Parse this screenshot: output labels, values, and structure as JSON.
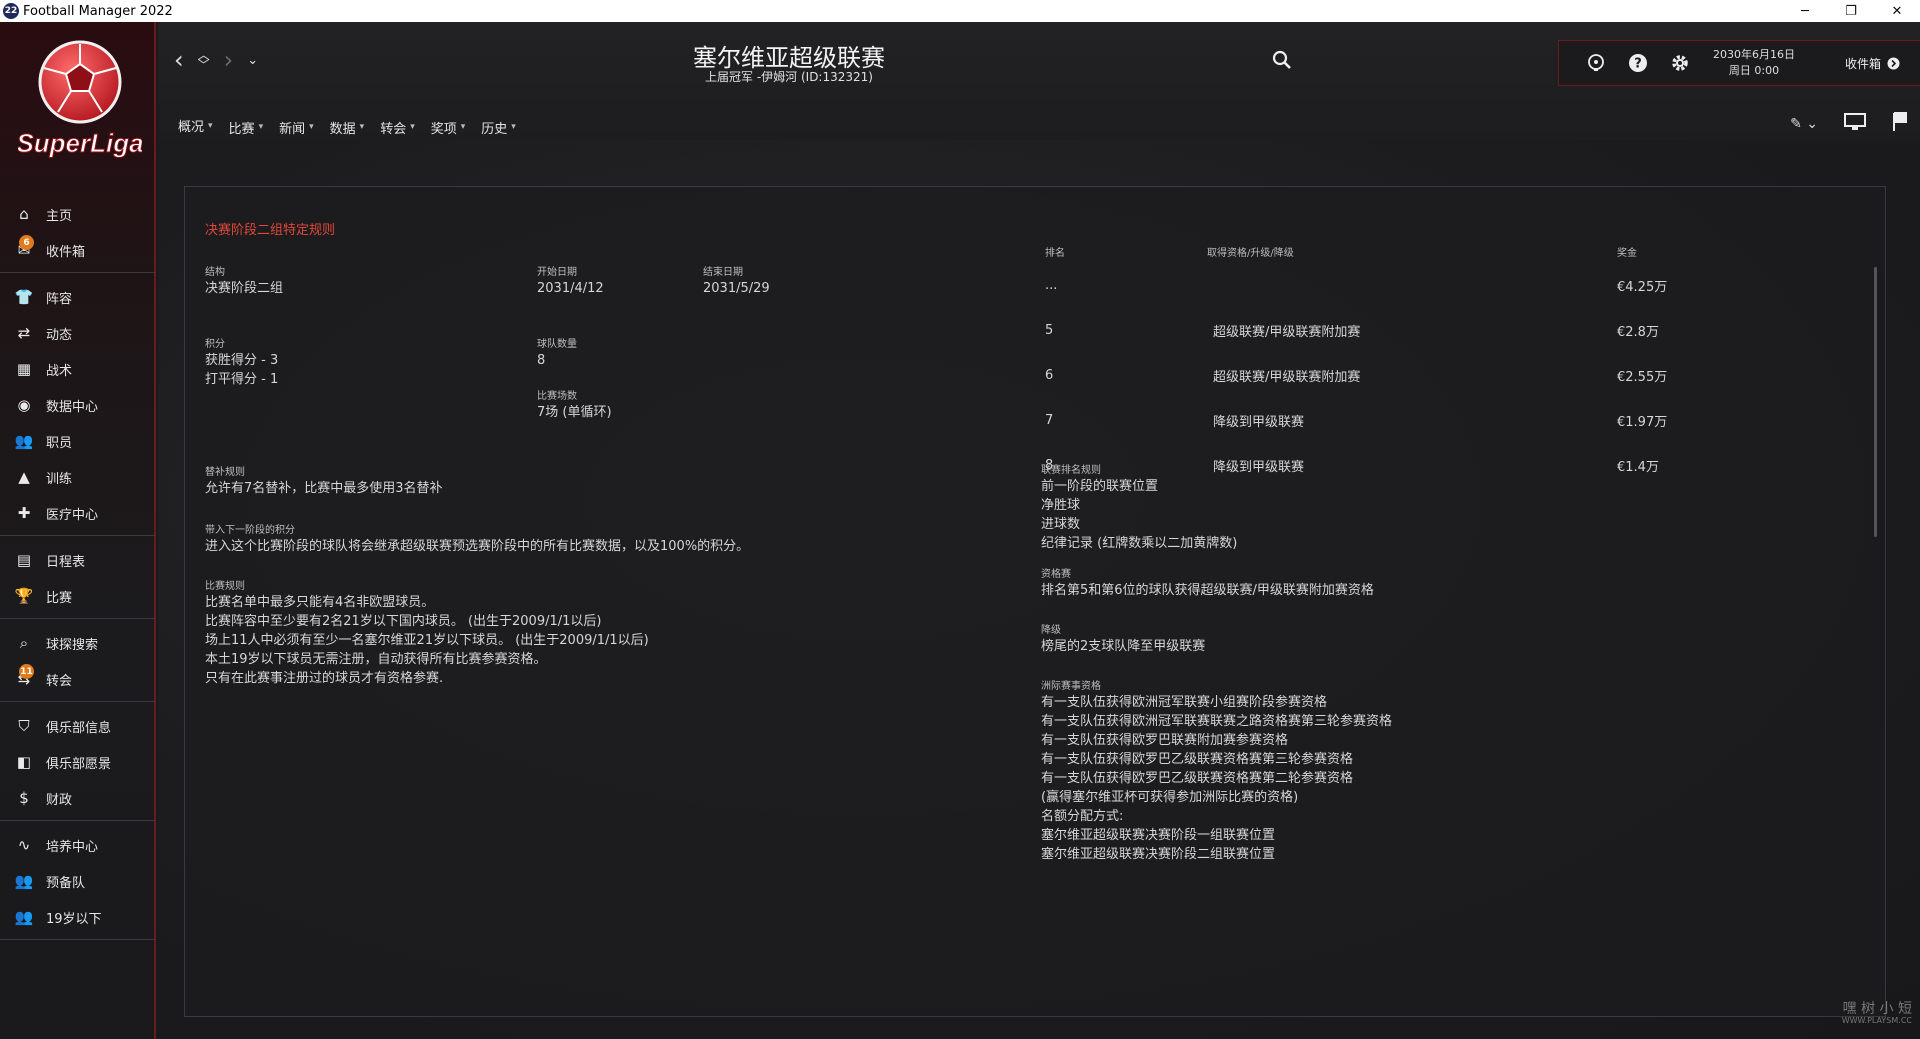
{
  "window": {
    "title": "Football Manager 2022",
    "app_icon_text": "22",
    "minimize": "─",
    "restore": "❐",
    "close": "✕"
  },
  "logo": {
    "text": "SuperLiga"
  },
  "sidebar": {
    "groups": [
      [
        {
          "label": "主页",
          "icon": "home-icon"
        },
        {
          "label": "收件箱",
          "icon": "inbox-icon",
          "badge": "6"
        }
      ],
      [
        {
          "label": "阵容",
          "icon": "jersey-icon"
        },
        {
          "label": "动态",
          "icon": "dynamics-icon"
        },
        {
          "label": "战术",
          "icon": "tactics-icon"
        },
        {
          "label": "数据中心",
          "icon": "data-hub-icon"
        },
        {
          "label": "职员",
          "icon": "staff-icon"
        },
        {
          "label": "训练",
          "icon": "training-icon"
        },
        {
          "label": "医疗中心",
          "icon": "medical-icon"
        }
      ],
      [
        {
          "label": "日程表",
          "icon": "calendar-icon"
        },
        {
          "label": "比赛",
          "icon": "trophy-icon"
        }
      ],
      [
        {
          "label": "球探搜索",
          "icon": "scout-search-icon"
        },
        {
          "label": "转会",
          "icon": "transfer-icon",
          "badge": "11"
        }
      ],
      [
        {
          "label": "俱乐部信息",
          "icon": "club-info-icon"
        },
        {
          "label": "俱乐部愿景",
          "icon": "club-vision-icon"
        },
        {
          "label": "财政",
          "icon": "finance-icon"
        }
      ],
      [
        {
          "label": "培养中心",
          "icon": "development-icon"
        },
        {
          "label": "预备队",
          "icon": "reserve-team-icon"
        },
        {
          "label": "19岁以下",
          "icon": "u19-icon"
        }
      ]
    ]
  },
  "header": {
    "title": "塞尔维亚超级联赛",
    "subtitle": "上届冠军 -伊姆河 (ID:132321)",
    "date_line1": "2030年6月16日",
    "date_line2": "周日 0:00",
    "inbox_label": "收件箱",
    "tabs": [
      "概况",
      "比赛",
      "新闻",
      "数据",
      "转会",
      "奖项",
      "历史"
    ]
  },
  "panel": {
    "title": "决赛阶段二组特定规则",
    "structure": {
      "label": "结构",
      "value": "决赛阶段二组"
    },
    "start_date": {
      "label": "开始日期",
      "value": "2031/4/12"
    },
    "end_date": {
      "label": "结束日期",
      "value": "2031/5/29"
    },
    "points": {
      "label": "积分",
      "lines": [
        "获胜得分 - 3",
        "打平得分 - 1"
      ]
    },
    "team_count": {
      "label": "球队数量",
      "value": "8"
    },
    "match_count": {
      "label": "比赛场数",
      "value": "7场 (单循环)"
    },
    "substitution": {
      "label": "替补规则",
      "value": "允许有7名替补，比赛中最多使用3名替补"
    },
    "carry_over": {
      "label": "带入下一阶段的积分",
      "value": "进入这个比赛阶段的球队将会继承超级联赛预选赛阶段中的所有比赛数据，以及100%的积分。"
    },
    "competition_rules": {
      "label": "比赛规则",
      "lines": [
        "比赛名单中最多只能有4名非欧盟球员。",
        "比赛阵容中至少要有2名21岁以下国内球员。 (出生于2009/1/1以后)",
        "场上11人中必须有至少一名塞尔维亚21岁以下球员。 (出生于2009/1/1以后)",
        "本土19岁以下球员无需注册，自动获得所有比赛参赛资格。",
        "只有在此赛事注册过的球员才有资格参赛."
      ]
    },
    "prize_table": {
      "headers": [
        "排名",
        "取得资格/升级/降级",
        "奖金"
      ],
      "rows": [
        {
          "rank": "...",
          "qual": "",
          "prize": "€4.25万"
        },
        {
          "rank": "5",
          "qual": "超级联赛/甲级联赛附加赛",
          "prize": "€2.8万"
        },
        {
          "rank": "6",
          "qual": "超级联赛/甲级联赛附加赛",
          "prize": "€2.55万"
        },
        {
          "rank": "7",
          "qual": "降级到甲级联赛",
          "prize": "€1.97万"
        },
        {
          "rank": "8",
          "qual": "降级到甲级联赛",
          "prize": "€1.4万"
        }
      ]
    },
    "ranking_rules": {
      "label": "联赛排名规则",
      "lines": [
        "前一阶段的联赛位置",
        "净胜球",
        "进球数",
        "纪律记录 (红牌数乘以二加黄牌数)"
      ]
    },
    "qualification": {
      "label": "资格赛",
      "value": "排名第5和第6位的球队获得超级联赛/甲级联赛附加赛资格"
    },
    "relegation": {
      "label": "降级",
      "value": "榜尾的2支球队降至甲级联赛"
    },
    "continental": {
      "label": "洲际赛事资格",
      "lines": [
        "有一支队伍获得欧洲冠军联赛小组赛阶段参赛资格",
        "有一支队伍获得欧洲冠军联赛联赛之路资格赛第三轮参赛资格",
        "有一支队伍获得欧罗巴联赛附加赛参赛资格",
        "有一支队伍获得欧罗巴乙级联赛资格赛第三轮参赛资格",
        "有一支队伍获得欧罗巴乙级联赛资格赛第二轮参赛资格",
        "(赢得塞尔维亚杯可获得参加洲际比赛的资格)",
        "名额分配方式:",
        "塞尔维亚超级联赛决赛阶段一组联赛位置",
        "塞尔维亚超级联赛决赛阶段二组联赛位置"
      ]
    }
  },
  "watermark": {
    "line1": "嘿 树 小 短",
    "line2": "WWW.PLAYSM.CC"
  },
  "colors": {
    "accent": "#e0473a",
    "brand": "#6b1a22",
    "badge": "#e07a1a"
  }
}
